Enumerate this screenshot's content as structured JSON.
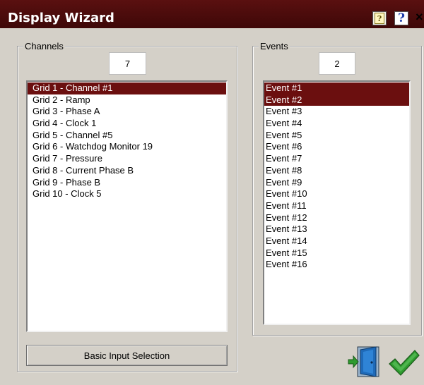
{
  "window": {
    "title": "Display Wizard",
    "close_label": "×"
  },
  "channels": {
    "group_label": "Channels",
    "count": "7",
    "items": [
      {
        "label": "Grid 1 - Channel #1",
        "selected": true
      },
      {
        "label": "Grid 2 - Ramp",
        "selected": false
      },
      {
        "label": "Grid 3 - Phase A",
        "selected": false
      },
      {
        "label": "Grid 4 - Clock 1",
        "selected": false
      },
      {
        "label": "Grid 5 - Channel #5",
        "selected": false
      },
      {
        "label": "Grid 6 - Watchdog Monitor 19",
        "selected": false
      },
      {
        "label": "Grid 7 - Pressure",
        "selected": false
      },
      {
        "label": "Grid 8 - Current Phase B",
        "selected": false
      },
      {
        "label": "Grid 9 - Phase B",
        "selected": false
      },
      {
        "label": "Grid 10 - Clock 5",
        "selected": false
      }
    ],
    "basic_input_button": "Basic Input Selection"
  },
  "events": {
    "group_label": "Events",
    "count": "2",
    "items": [
      {
        "label": "Event #1",
        "selected": true
      },
      {
        "label": "Event #2",
        "selected": true
      },
      {
        "label": "Event #3",
        "selected": false
      },
      {
        "label": "Event #4",
        "selected": false
      },
      {
        "label": "Event #5",
        "selected": false
      },
      {
        "label": "Event #6",
        "selected": false
      },
      {
        "label": "Event #7",
        "selected": false
      },
      {
        "label": "Event #8",
        "selected": false
      },
      {
        "label": "Event #9",
        "selected": false
      },
      {
        "label": "Event #10",
        "selected": false
      },
      {
        "label": "Event #11",
        "selected": false
      },
      {
        "label": "Event #12",
        "selected": false
      },
      {
        "label": "Event #13",
        "selected": false
      },
      {
        "label": "Event #14",
        "selected": false
      },
      {
        "label": "Event #15",
        "selected": false
      },
      {
        "label": "Event #16",
        "selected": false
      }
    ]
  },
  "icons": {
    "help_context": "help-context-icon",
    "help_topics": "help-question-icon",
    "exit": "exit-door-icon",
    "ok": "checkmark-icon"
  },
  "colors": {
    "titlebar": "#4a0b0b",
    "selection": "#6b0f0f",
    "window_bg": "#d4d0c8",
    "checkmark": "#2e9a2e",
    "door": "#1f6ab8"
  }
}
